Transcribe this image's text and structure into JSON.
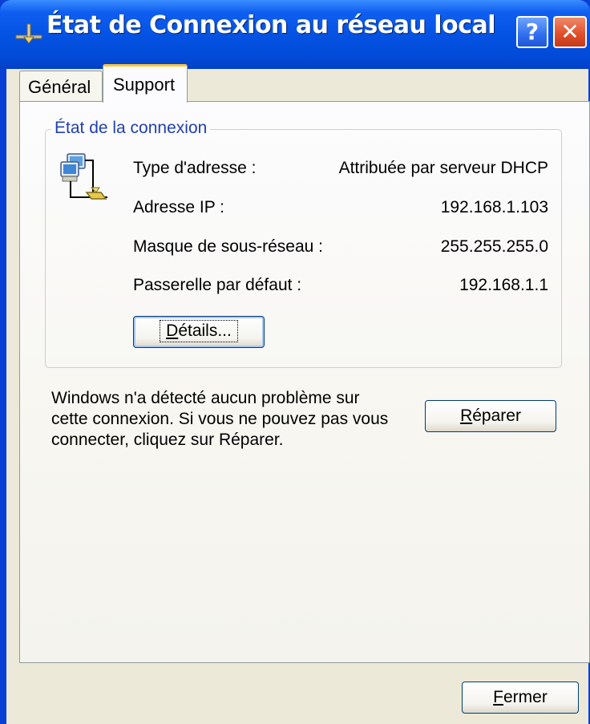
{
  "window": {
    "title": "État de Connexion au réseau local",
    "title_icon": "network-connection-icon",
    "help_label": "?",
    "close_label": "✕"
  },
  "tabs": [
    {
      "label": "Général",
      "selected": false
    },
    {
      "label": "Support",
      "selected": true
    }
  ],
  "connection_status": {
    "legend": "État de la connexion",
    "icon": "network-computers-icon",
    "rows": [
      {
        "label": "Type d'adresse :",
        "value": "Attribuée par serveur DHCP"
      },
      {
        "label": "Adresse IP :",
        "value": "192.168.1.103"
      },
      {
        "label": "Masque de sous-réseau :",
        "value": "255.255.255.0"
      },
      {
        "label": "Passerelle par défaut :",
        "value": "192.168.1.1"
      }
    ],
    "details_button": {
      "accel": "D",
      "rest": "étails..."
    }
  },
  "message": {
    "line1": "Windows n'a détecté aucun problème sur",
    "line2": "cette connexion. Si vous ne pouvez pas vous",
    "line3": "connecter, cliquez sur Réparer."
  },
  "repair_button": {
    "accel": "R",
    "rest": "éparer"
  },
  "close_button": {
    "accel": "F",
    "rest": "ermer"
  },
  "colors": {
    "titlebar": "#0553e3",
    "client": "#ece9d8",
    "legend_text": "#1f3fb0",
    "tab_highlight": "#ffc83c",
    "close_button": "#e0502c"
  }
}
